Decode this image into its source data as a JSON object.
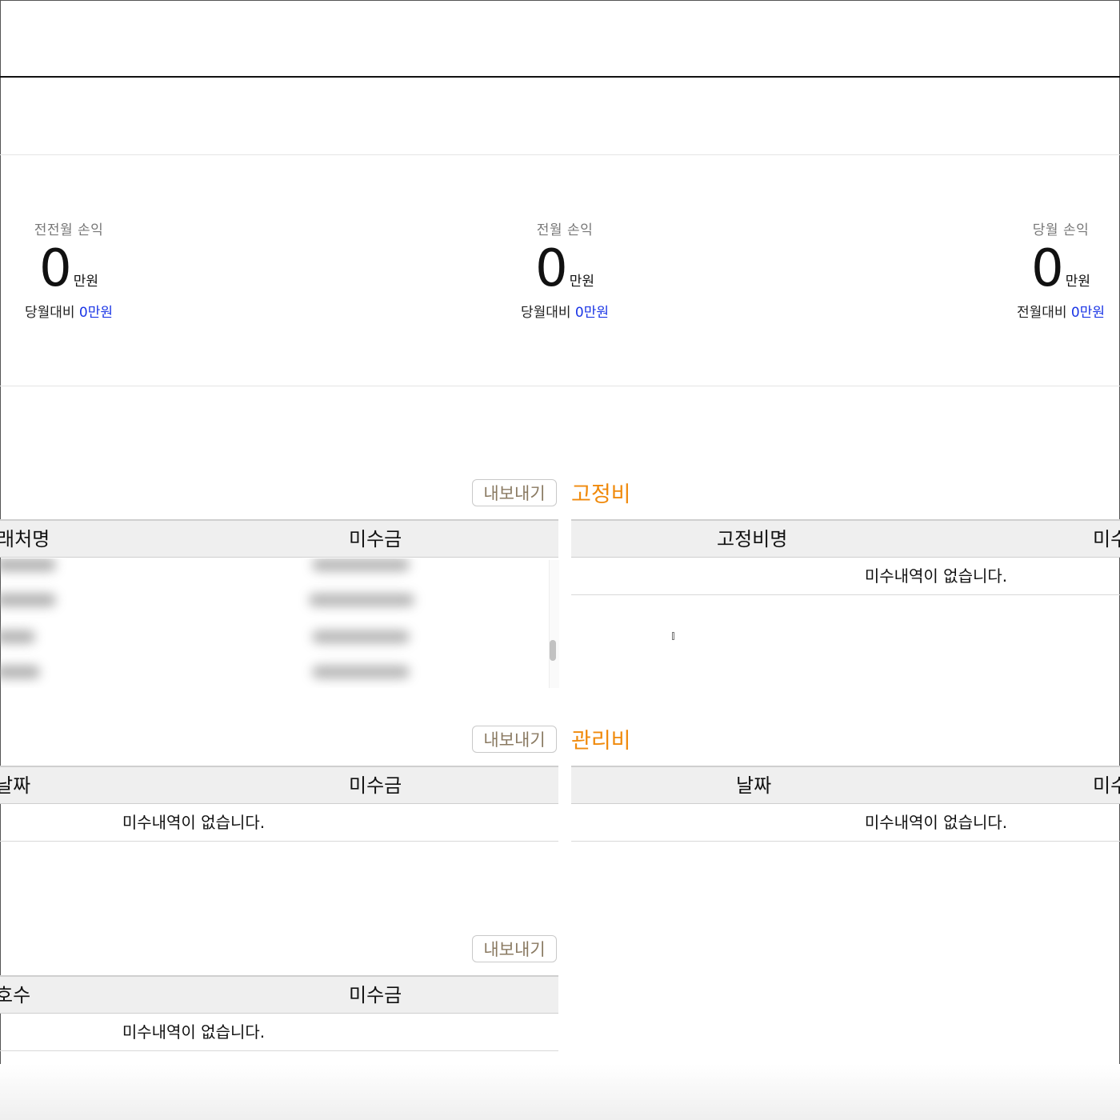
{
  "summary": [
    {
      "label": "전전월 손익",
      "value": "0",
      "unit": "만원",
      "compare_prefix": "당월대비 ",
      "compare_value": "0만원"
    },
    {
      "label": "전월 손익",
      "value": "0",
      "unit": "만원",
      "compare_prefix": "당월대비 ",
      "compare_value": "0만원"
    },
    {
      "label": "당월 손익",
      "value": "0",
      "unit": "만원",
      "compare_prefix": "전월대비 ",
      "compare_value": "0만원"
    }
  ],
  "export_label": "내보내기",
  "empty_message": "미수내역이 없습니다.",
  "left_tables": [
    {
      "col1": "래처명",
      "col2": "미수금"
    },
    {
      "col1": "날짜",
      "col2": "미수금"
    },
    {
      "col1": "호수",
      "col2": "미수금"
    }
  ],
  "fixed_cost": {
    "title": "고정비",
    "col1": "고정비명",
    "col2": "미수"
  },
  "management_fee": {
    "title": "관리비",
    "col1": "날짜",
    "col2": "미수"
  },
  "colors": {
    "accent_orange": "#f08a0c",
    "compare_blue": "#1a35e6",
    "export_text": "#8a7a62"
  }
}
